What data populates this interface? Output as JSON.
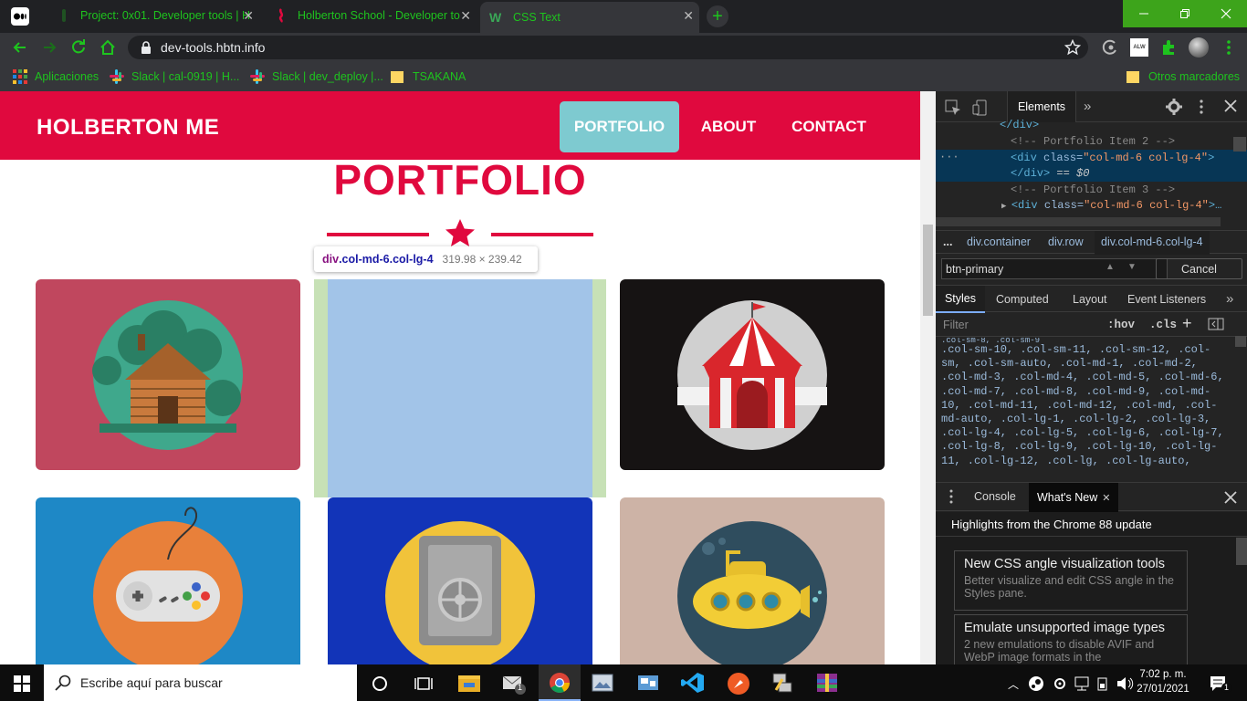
{
  "browser": {
    "tabs": [
      {
        "title": "Project: 0x01. Developer tools | H"
      },
      {
        "title": "Holberton School - Developer to"
      },
      {
        "title": "CSS Text"
      }
    ],
    "new_tab": "+",
    "address": "dev-tools.hbtn.info",
    "bookmarks": [
      {
        "label": "Aplicaciones"
      },
      {
        "label": "Slack | cal-0919 | H..."
      },
      {
        "label": "Slack | dev_deploy |..."
      },
      {
        "label": "TSAKANA"
      },
      {
        "label": "Otros marcadores"
      }
    ],
    "ext_badge": "ALW"
  },
  "page": {
    "brand": "HOLBERTON ME",
    "nav": [
      {
        "label": "PORTFOLIO"
      },
      {
        "label": "ABOUT"
      },
      {
        "label": "CONTACT"
      }
    ],
    "title": "PORTFOLIO",
    "tooltip": {
      "tag": "div",
      "selector": ".col-md-6.col-lg-4",
      "size": "319.98 × 239.42"
    },
    "cards": [
      {
        "icon": "cabin-icon",
        "bg": "#c0475e"
      },
      {
        "icon": "highlighted-empty",
        "bg": "#a2c4e8"
      },
      {
        "icon": "circus-tent-icon",
        "bg": "#161313"
      },
      {
        "icon": "gamepad-icon",
        "bg": "#1e88c6"
      },
      {
        "icon": "safe-icon",
        "bg": "#1234b8"
      },
      {
        "icon": "submarine-icon",
        "bg": "#cdb3a6"
      }
    ],
    "accent": "#e0093e",
    "nav_active_bg": "#7ecad0"
  },
  "devtools": {
    "main_tabs": [
      "Elements"
    ],
    "dom_lines": [
      "</div>",
      "<!-- Portfolio Item 2 -->",
      "<div class=\"col-md-6 col-lg-4\">",
      "</div> == $0",
      "<!-- Portfolio Item 3 -->",
      "<div class=\"col-md-6 col-lg-4\">..."
    ],
    "dom_parts": {
      "sel_tag_open": "<div ",
      "sel_attr": "class=",
      "sel_val": "\"col-md-6 col-lg-4\"",
      "sel_close": "</div>",
      "dollar": " == $0",
      "item3_tag": "<div ",
      "item3_attr": "class=",
      "item3_val": "\"col-md-6 col-lg-4\"",
      "item3_end": ">…"
    },
    "breadcrumbs": [
      "...",
      "div.container",
      "div.row",
      "div.col-md-6.col-lg-4"
    ],
    "search_value": "btn-primary",
    "cancel": "Cancel",
    "sub_tabs": [
      "Styles",
      "Computed",
      "Layout",
      "Event Listeners"
    ],
    "filter_placeholder": "Filter",
    "hov": ":hov",
    "cls": ".cls",
    "css_lines": [
      ".col-sm-10, .col-sm-11, .col-sm-12, .col-",
      "sm, .col-sm-auto, .col-md-1, .col-md-2,",
      ".col-md-3, .col-md-4, .col-md-5, .col-md-6,",
      ".col-md-7, .col-md-8, .col-md-9, .col-md-",
      "10, .col-md-11, .col-md-12, .col-md, .col-",
      "md-auto, .col-lg-1, .col-lg-2, .col-lg-3,",
      ".col-lg-4, .col-lg-5, .col-lg-6, .col-lg-7,",
      ".col-lg-8, .col-lg-9, .col-lg-10, .col-lg-",
      "11, .col-lg-12, .col-lg, .col-lg-auto,"
    ],
    "drawer_tabs": [
      "Console",
      "What's New"
    ],
    "whatsnew_title": "Highlights from the Chrome 88 update",
    "news": [
      {
        "title": "New CSS angle visualization tools",
        "desc": "Better visualize and edit CSS angle in the Styles pane."
      },
      {
        "title": "Emulate unsupported image types",
        "desc": "2 new emulations to disable AVIF and WebP image formats in the"
      }
    ]
  },
  "taskbar": {
    "search_placeholder": "Escribe aquí para buscar",
    "time": "7:02 p. m.",
    "date": "27/01/2021",
    "mail_badge": "1",
    "notif_badge": "1"
  }
}
